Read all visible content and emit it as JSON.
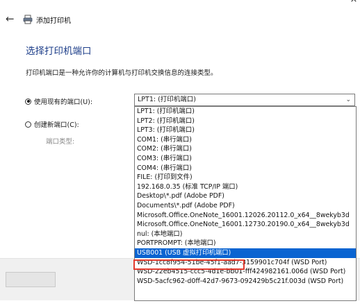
{
  "window": {
    "title": "添加打印机",
    "close_glyph": "×",
    "back_glyph": "←"
  },
  "page": {
    "heading": "选择打印机端口",
    "description": "打印机端口是一种允许你的计算机与打印机交换信息的连接类型。"
  },
  "options": {
    "use_existing_label": "使用现有的端口(U):",
    "create_new_label": "创建新端口(C):",
    "port_type_label": "端口类型:"
  },
  "combo": {
    "selected_value": "LPT1: (打印机端口)",
    "chevron": "⌄"
  },
  "dropdown": {
    "items": [
      "LPT1: (打印机端口)",
      "LPT2: (打印机端口)",
      "LPT3: (打印机端口)",
      "COM1: (串行端口)",
      "COM2: (串行端口)",
      "COM3: (串行端口)",
      "COM4: (串行端口)",
      "FILE: (打印到文件)",
      "192.168.0.35 (标准 TCP/IP 端口)",
      "Desktop\\*.pdf (Adobe PDF)",
      "Documents\\*.pdf (Adobe PDF)",
      "Microsoft.Office.OneNote_16001.12026.20112.0_x64__8wekyb3d",
      "Microsoft.Office.OneNote_16001.12730.20190.0_x64__8wekyb3d",
      "nul: (本地端口)",
      "PORTPROMPT: (本地端口)",
      "USB001 (USB 虚拟打印机端口)",
      "WSD-1cc8f954-51be-45f1-aad7-3159901c704f (WSD Port)",
      "WSD-22eb4515-ccc5-4d1e-bb01-fff424982161.006d (WSD Port)",
      "WSD-5acfc962-d0ff-42d7-9673-092429b5c21f.003d (WSD Port)"
    ],
    "selected_index": 15
  },
  "colors": {
    "heading": "#1e3f8a",
    "selection": "#0a64d1",
    "highlight_border": "#e23a2e"
  }
}
